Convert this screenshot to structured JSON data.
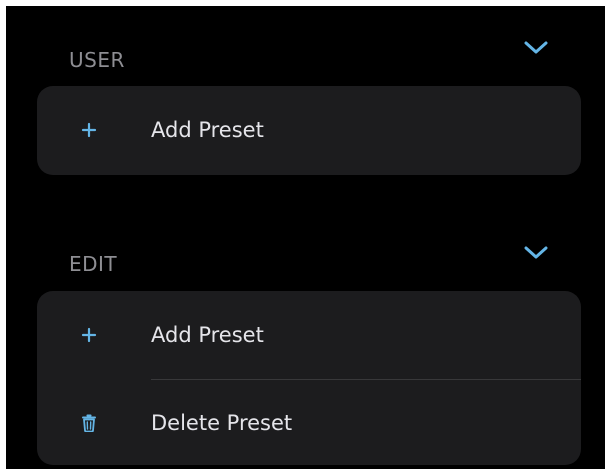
{
  "colors": {
    "background": "#000000",
    "card": "#1c1c1e",
    "accent": "#64b5e6",
    "section_title": "#8e8e93",
    "label": "#e5e5ea",
    "divider": "#38383a"
  },
  "sections": {
    "user": {
      "title": "USER",
      "toggle_icon": "chevron-down-icon",
      "items": [
        {
          "label": "Add Preset",
          "icon": "plus-icon"
        }
      ]
    },
    "edit": {
      "title": "EDIT",
      "toggle_icon": "chevron-down-icon",
      "items": [
        {
          "label": "Add Preset",
          "icon": "plus-icon"
        },
        {
          "label": "Delete Preset",
          "icon": "trash-icon"
        }
      ]
    }
  }
}
